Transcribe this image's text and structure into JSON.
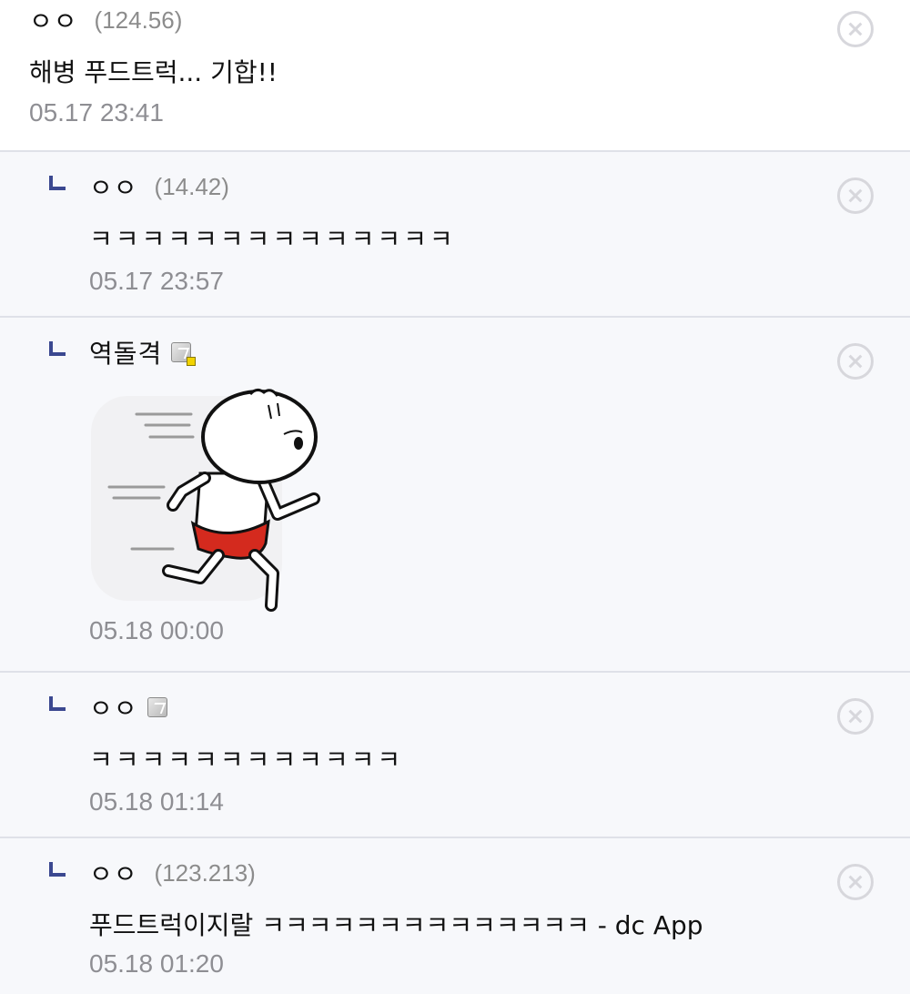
{
  "comments": [
    {
      "nickname": "ㅇㅇ",
      "ip": "(124.56)",
      "text": "해병 푸드트럭... 기합!!",
      "date": "05.17 23:41"
    },
    {
      "nickname": "ㅇㅇ",
      "ip": "(14.42)",
      "text": "ㅋㅋㅋㅋㅋㅋㅋㅋㅋㅋㅋㅋㅋㅋ",
      "date": "05.17 23:57"
    },
    {
      "nickname": "역돌격",
      "date": "05.18 00:00",
      "icon": "fixed-gallog-icon",
      "sticker": "running-dumpling-character-sticker"
    },
    {
      "nickname": "ㅇㅇ",
      "text": "ㅋㅋㅋㅋㅋㅋㅋㅋㅋㅋㅋㅋ",
      "date": "05.18 01:14",
      "icon": "gallog-icon"
    },
    {
      "nickname": "ㅇㅇ",
      "ip": "(123.213)",
      "text": "푸드트럭이지랄 ㅋㅋㅋㅋㅋㅋㅋㅋㅋㅋㅋㅋㅋㅋ - dc App",
      "date": "05.18 01:20"
    }
  ],
  "colors": {
    "reply_bg": "#f7f8fb",
    "reply_mark": "#3b4890",
    "date_text": "#8e8e93",
    "ip_text": "#8c8c8c",
    "divider": "#dfe1e8"
  },
  "icons": {
    "reply": "reply-arrow-icon",
    "delete": "delete-circle-icon"
  }
}
